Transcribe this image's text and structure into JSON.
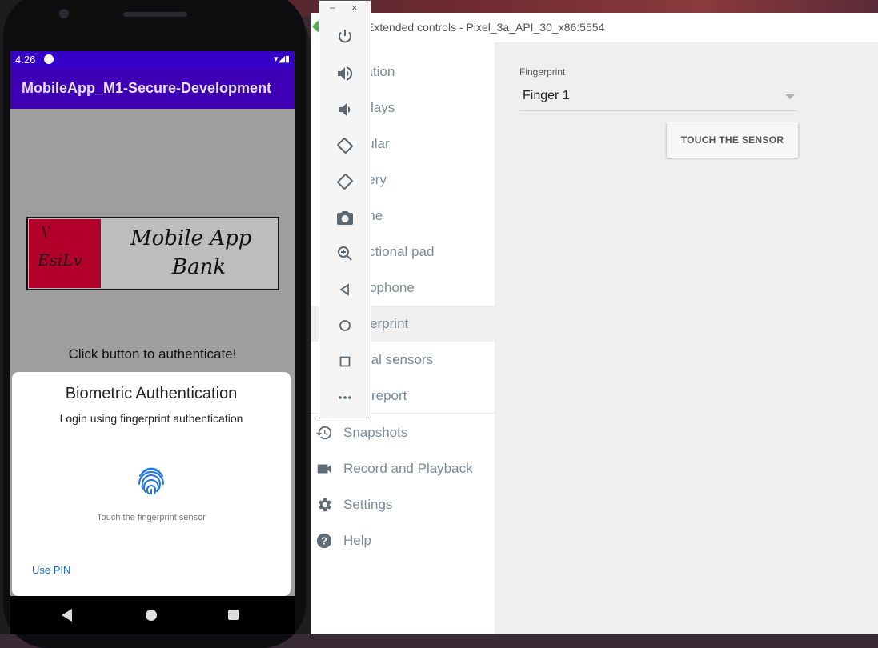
{
  "extended_controls": {
    "window_title": "Extended controls - Pixel_3a_API_30_x86:5554",
    "nav_items": [
      {
        "label": "Location",
        "icon": "location-icon"
      },
      {
        "label": "Displays",
        "icon": "displays-icon"
      },
      {
        "label": "Cellular",
        "icon": "cellular-icon"
      },
      {
        "label": "Battery",
        "icon": "battery-icon"
      },
      {
        "label": "Phone",
        "icon": "phone-icon"
      },
      {
        "label": "Directional pad",
        "icon": "dpad-icon"
      },
      {
        "label": "Microphone",
        "icon": "microphone-icon"
      },
      {
        "label": "Fingerprint",
        "icon": "fingerprint-icon"
      },
      {
        "label": "Virtual sensors",
        "icon": "sensors-icon"
      },
      {
        "label": "Bug report",
        "icon": "bug-icon"
      },
      {
        "label": "Snapshots",
        "icon": "history-icon"
      },
      {
        "label": "Record and Playback",
        "icon": "videocam-icon"
      },
      {
        "label": "Settings",
        "icon": "gear-icon"
      },
      {
        "label": "Help",
        "icon": "help-icon"
      }
    ],
    "fingerprint": {
      "label": "Fingerprint",
      "selected": "Finger 1",
      "touch_button": "TOUCH THE SENSOR"
    }
  },
  "toolbar": {
    "minimize": "–",
    "close": "×"
  },
  "phone": {
    "status_time": "4:26",
    "app_title": "MobileApp_M1-Secure-Development",
    "logo": {
      "left_text": "EsiLv",
      "mark": "\\`",
      "line1": "Mobile App",
      "line2": "Bank"
    },
    "prompt": "Click button to authenticate!",
    "dialog": {
      "title": "Biometric Authentication",
      "subtitle": "Login using fingerprint authentication",
      "hint": "Touch the fingerprint sensor",
      "use_pin": "Use PIN"
    }
  }
}
